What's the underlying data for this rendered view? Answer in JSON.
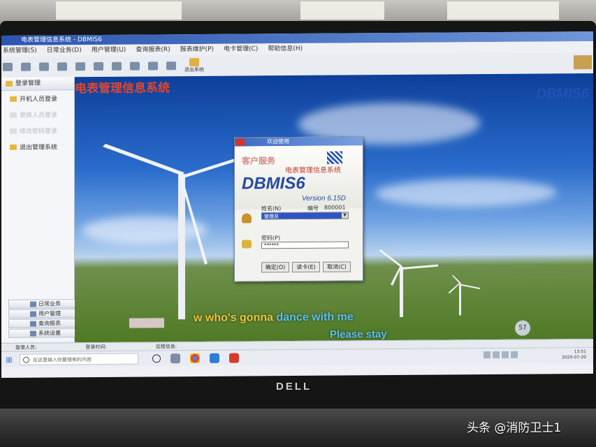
{
  "app": {
    "title": "电表管理信息系统 - DBMIS6",
    "menu": [
      "系统管理(S)",
      "日常业务(D)",
      "用户管理(U)",
      "查询报表(R)",
      "报表维护(P)",
      "电卡管理(C)",
      "帮助信息(H)"
    ],
    "toolbar": {
      "exit_label": "退出系统"
    }
  },
  "sidebar": {
    "header": "登录管理",
    "items": [
      {
        "label": "开机人员登录",
        "enabled": true
      },
      {
        "label": "更换人员登录",
        "enabled": false
      },
      {
        "label": "修改密码登录",
        "enabled": false
      },
      {
        "label": "退出管理系统",
        "enabled": true
      }
    ],
    "bottom_tabs": [
      "日常业务",
      "用户管理",
      "查询报表",
      "系统设置"
    ]
  },
  "wallpaper": {
    "title": "电表管理信息系统",
    "brand": "DBMIS6",
    "lyrics_line1_a": "w who's gonna ",
    "lyrics_line1_b": "dance with me",
    "lyrics_line2": "Please stay"
  },
  "dialog": {
    "title": "欢迎使用",
    "subtitle": "客户服务",
    "subtitle2": "电表管理信息系统",
    "product": "DBMIS6",
    "version": "Version 6.15D",
    "name_label": "姓名(N)",
    "id_label": "编号",
    "id_value": "800001",
    "selected_user": "管理员",
    "password_label": "密码(P)",
    "password_value": "******",
    "buttons": {
      "ok": "确定(O)",
      "card": "读卡(E)",
      "cancel": "取消(C)"
    }
  },
  "statusbar": {
    "user": "登录人员:",
    "time": "登录时间:",
    "info": "远程信息:"
  },
  "taskbar": {
    "search_placeholder": "在这里输入你要搜索的内容",
    "time": "13:51",
    "date": "2020-07-20",
    "badge": "57"
  },
  "watermark": "头条 @消防卫士1",
  "bezel_brand": "DELL"
}
